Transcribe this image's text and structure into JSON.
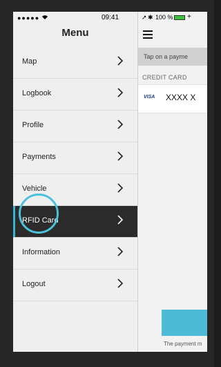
{
  "status_bar": {
    "signal": "●●●●●",
    "time": "09:41",
    "battery_percent": "100 %"
  },
  "drawer": {
    "title": "Menu",
    "items": [
      {
        "label": "Map"
      },
      {
        "label": "Logbook"
      },
      {
        "label": "Profile"
      },
      {
        "label": "Payments"
      },
      {
        "label": "Vehicle"
      },
      {
        "label": "RFID Card",
        "active": true
      },
      {
        "label": "Information"
      },
      {
        "label": "Logout"
      }
    ]
  },
  "background_page": {
    "header_hint": "Tap on a payme",
    "section_title": "CREDIT CARD",
    "card_brand": "VISA",
    "card_number": "XXXX X",
    "footer_note": "The payment m"
  },
  "colors": {
    "active_item_bg": "#2b2b2b",
    "accent": "#38b3d1",
    "tap_indicator": "#4dc1dc"
  }
}
